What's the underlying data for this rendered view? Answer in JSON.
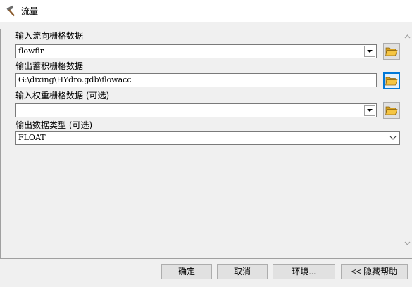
{
  "window": {
    "title": "流量",
    "icon": "hammer-icon"
  },
  "form": {
    "input_flow_direction": {
      "label": "输入流向栅格数据",
      "value": "flowfir"
    },
    "output_accumulation": {
      "label": "输出蓄积栅格数据",
      "value": "G:\\dixing\\HYdro.gdb\\flowacc"
    },
    "input_weight": {
      "label": "输入权重栅格数据 (可选)",
      "value": ""
    },
    "output_data_type": {
      "label": "输出数据类型 (可选)",
      "value": "FLOAT"
    }
  },
  "buttons": {
    "ok": "确定",
    "cancel": "取消",
    "environments": "环境...",
    "hide_help": "<< 隐藏帮助"
  },
  "colors": {
    "client_bg": "#f0f0f0",
    "button_bg": "#e1e1e1",
    "active_border": "#0078d7",
    "folder_yellow": "#f5c542"
  }
}
